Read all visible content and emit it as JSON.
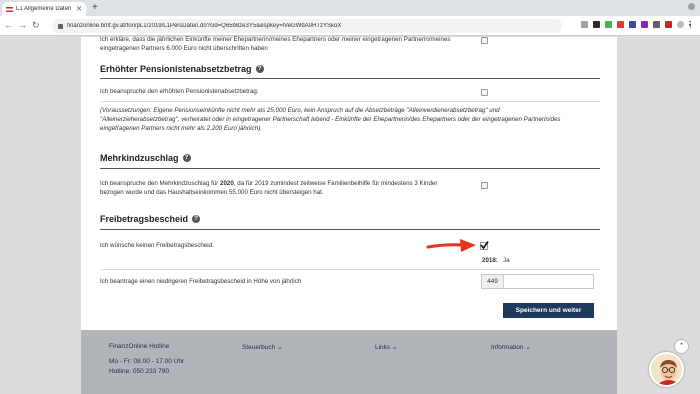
{
  "browser": {
    "tab_title": "L1 Allgemeine Daten",
    "url": "finanzonline.bmf.gv.at/fon/pL1/2019/L1PersDaten.do?cid=Q65b8ze3Y5&espkey=lVeGWdA0HTzYSkoX"
  },
  "top_partial_text_1": "Ich erkläre, dass die jährlichen Einkünfte meiner Ehepartnerin/meines Ehepartners oder meiner eingetragenen Partnerin/meines",
  "top_partial_text_2": "eingetragenen Partners 6.000 Euro nicht überschritten haben",
  "pension": {
    "heading": "Erhöhter Pensionistenabsetzbetrag",
    "claim": "Ich beanspruche den erhöhten Pensionistenabsetzbetrag.",
    "note_1": "(Voraussetzungen: Eigene Pensionseinkünfte nicht mehr als 25.000 Euro, kein Anspruch auf die Absetzbeträge \"Alleinverdienerabsetzbetrag\" und",
    "note_2": "\"Alleinerzieherabsetzbetrag\", verheiratet oder in eingetragener Partnerschaft lebend - Einkünfte der Ehepartnerin/des Ehepartners oder der eingetragenen Partnerin/des",
    "note_3": "eingetragenen Partners nicht mehr als 2.200 Euro jährlich)."
  },
  "mehrkind": {
    "heading": "Mehrkindzuschlag",
    "text_1a": "Ich beanspruche den Mehrkindzuschlag für ",
    "year": "2020",
    "text_1b": ", da für 2019 zumindest zeitweise Familienbeihilfe für mindestens 3 Kinder",
    "text_2": "bezogen wurde und das Haushaltseinkommen 55.000 Euro nicht übersteigen hat."
  },
  "freibetrag": {
    "heading": "Freibetragsbescheid",
    "no_notice": "Ich wünsche keinen Freibetragsbescheid.",
    "year_label": "2018:",
    "year_value": "Ja",
    "lower_notice": "Ich beantrage einen niedrigeren Freibetragsbescheid in Höhe von jährlich",
    "amount_prefix": "449",
    "amount_value": ""
  },
  "save_button": "Speichern und weiter",
  "footer": {
    "hotline_title": "FinanzOnline Hotline",
    "hours": "Mo - Fr: 08.00 - 17.00 Uhr",
    "phone": "Hotline: 050 233 790",
    "menu": [
      "Steuerbuch",
      "Links",
      "Information"
    ]
  },
  "colors": {
    "accent_button": "#1f3a5c",
    "arrow": "#e8341c",
    "footer_bg": "#b1b5b9"
  }
}
